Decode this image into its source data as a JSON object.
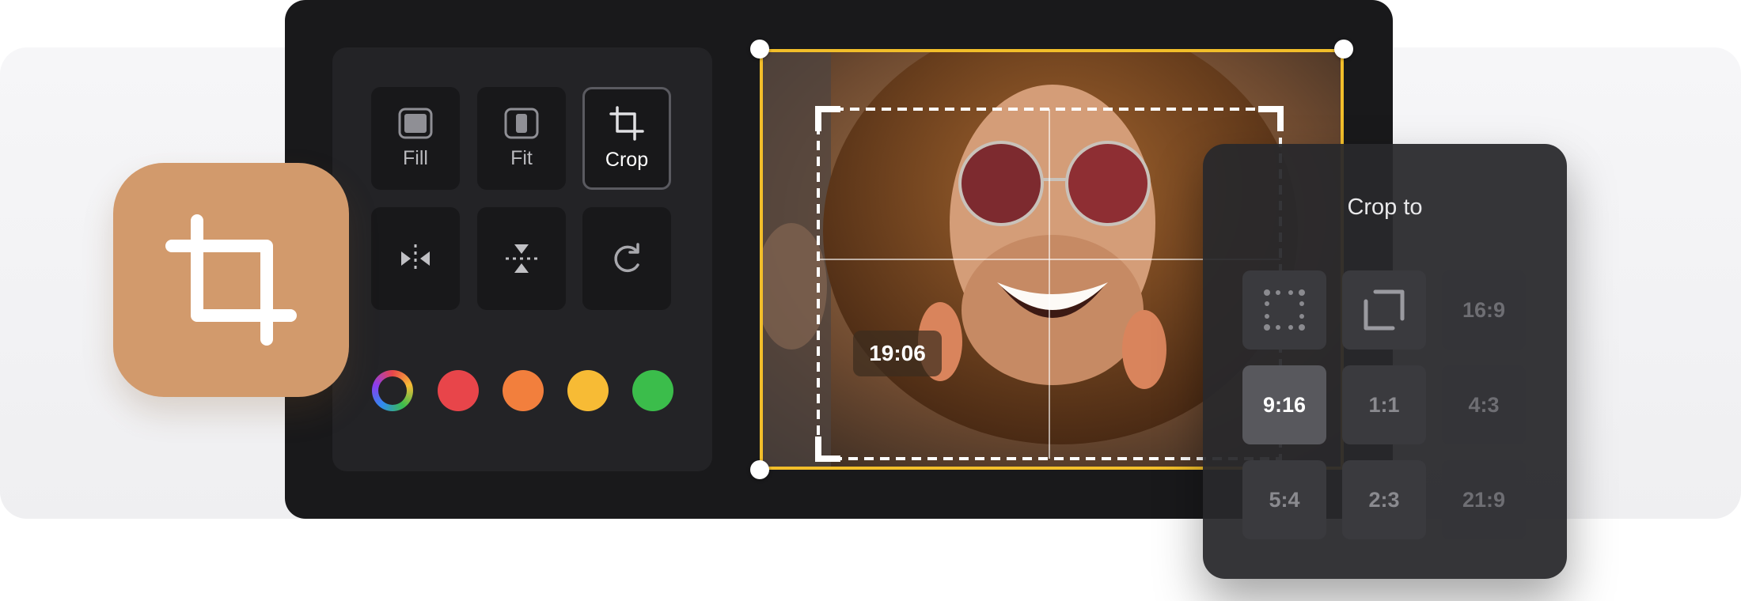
{
  "toolbar": {
    "fill_label": "Fill",
    "fit_label": "Fit",
    "crop_label": "Crop",
    "icons": [
      "fill-icon",
      "fit-icon",
      "crop-icon",
      "flip-horizontal-icon",
      "flip-vertical-icon",
      "rotate-icon"
    ]
  },
  "colors": {
    "swatches": [
      "#e8454a",
      "#f27f3d",
      "#f7bb35",
      "#3bbd4b"
    ],
    "accent": "#f2be2a",
    "app_icon_bg": "#d29a6c"
  },
  "editor": {
    "time_label": "19:06"
  },
  "crop_panel": {
    "title": "Crop to",
    "options": [
      "16:9",
      "9:16",
      "1:1",
      "4:3",
      "5:4",
      "2:3",
      "21:9"
    ],
    "selected": "9:16",
    "icons": [
      "freeform-icon",
      "custom-crop-icon"
    ]
  }
}
